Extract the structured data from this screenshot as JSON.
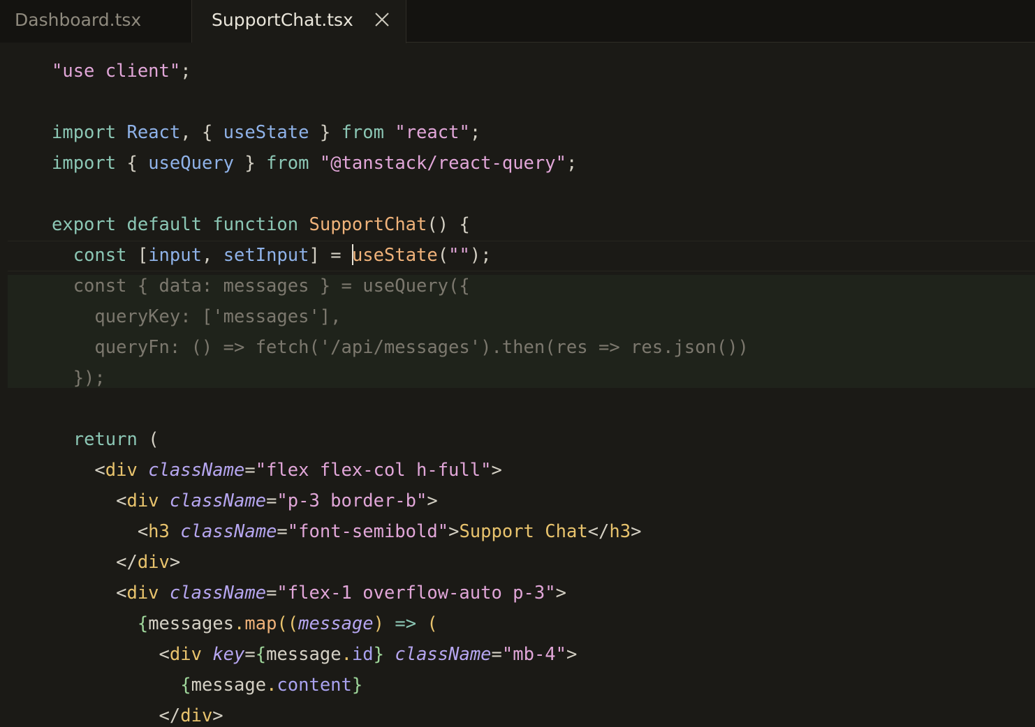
{
  "tabs": [
    {
      "label": "Dashboard.tsx",
      "active": false
    },
    {
      "label": "SupportChat.tsx",
      "active": true
    }
  ],
  "icons": {
    "tab_close": "close-icon"
  },
  "code": {
    "l1": {
      "a": "\"use client\"",
      "b": ";"
    },
    "l3": {
      "a": "import",
      "b": " ",
      "c": "React",
      "d": ", { ",
      "e": "useState",
      "f": " } ",
      "g": "from",
      "h": " ",
      "i": "\"react\"",
      "j": ";"
    },
    "l4": {
      "a": "import",
      "b": " { ",
      "c": "useQuery",
      "d": " } ",
      "e": "from",
      "f": " ",
      "g": "\"@tanstack/react-query\"",
      "h": ";"
    },
    "l6": {
      "a": "export",
      "b": " ",
      "c": "default",
      "d": " ",
      "e": "function",
      "f": " ",
      "g": "SupportChat",
      "h": "() {"
    },
    "l7": {
      "a": "  ",
      "b": "const",
      "c": " [",
      "d": "input",
      "e": ", ",
      "f": "setInput",
      "g": "] = ",
      "h": "useState",
      "i": "(",
      "j": "\"\"",
      "k": ");"
    },
    "l8": "  const { data: messages } = useQuery({",
    "l9": "    queryKey: ['messages'],",
    "l10": "    queryFn: () => fetch('/api/messages').then(res => res.json())",
    "l11": "  });",
    "l13": {
      "a": "  ",
      "b": "return",
      "c": " ("
    },
    "l14": {
      "a": "    <",
      "b": "div",
      "c": " ",
      "d": "className",
      "e": "=",
      "f": "\"flex flex-col h-full\"",
      "g": ">"
    },
    "l15": {
      "a": "      <",
      "b": "div",
      "c": " ",
      "d": "className",
      "e": "=",
      "f": "\"p-3 border-b\"",
      "g": ">"
    },
    "l16": {
      "a": "        <",
      "b": "h3",
      "c": " ",
      "d": "className",
      "e": "=",
      "f": "\"font-semibold\"",
      "g": ">",
      "h": "Support Chat",
      "i": "</",
      "j": "h3",
      "k": ">"
    },
    "l17": {
      "a": "      </",
      "b": "div",
      "c": ">"
    },
    "l18": {
      "a": "      <",
      "b": "div",
      "c": " ",
      "d": "className",
      "e": "=",
      "f": "\"flex-1 overflow-auto p-3\"",
      "g": ">"
    },
    "l19": {
      "a": "        ",
      "b": "{",
      "c": "messages",
      "d": ".",
      "e": "map",
      "f": "((",
      "g": "message",
      "h": ") ",
      "i": "=>",
      "j": " ("
    },
    "l20": {
      "a": "          <",
      "b": "div",
      "c": " ",
      "d": "key",
      "e": "=",
      "f": "{",
      "g": "message",
      "h": ".",
      "i": "id",
      "j": "}",
      "k": " ",
      "l": "className",
      "m": "=",
      "n": "\"mb-4\"",
      "o": ">"
    },
    "l21": {
      "a": "            ",
      "b": "{",
      "c": "message",
      "d": ".",
      "e": "content",
      "f": "}"
    },
    "l22": {
      "a": "          </",
      "b": "div",
      "c": ">"
    }
  }
}
